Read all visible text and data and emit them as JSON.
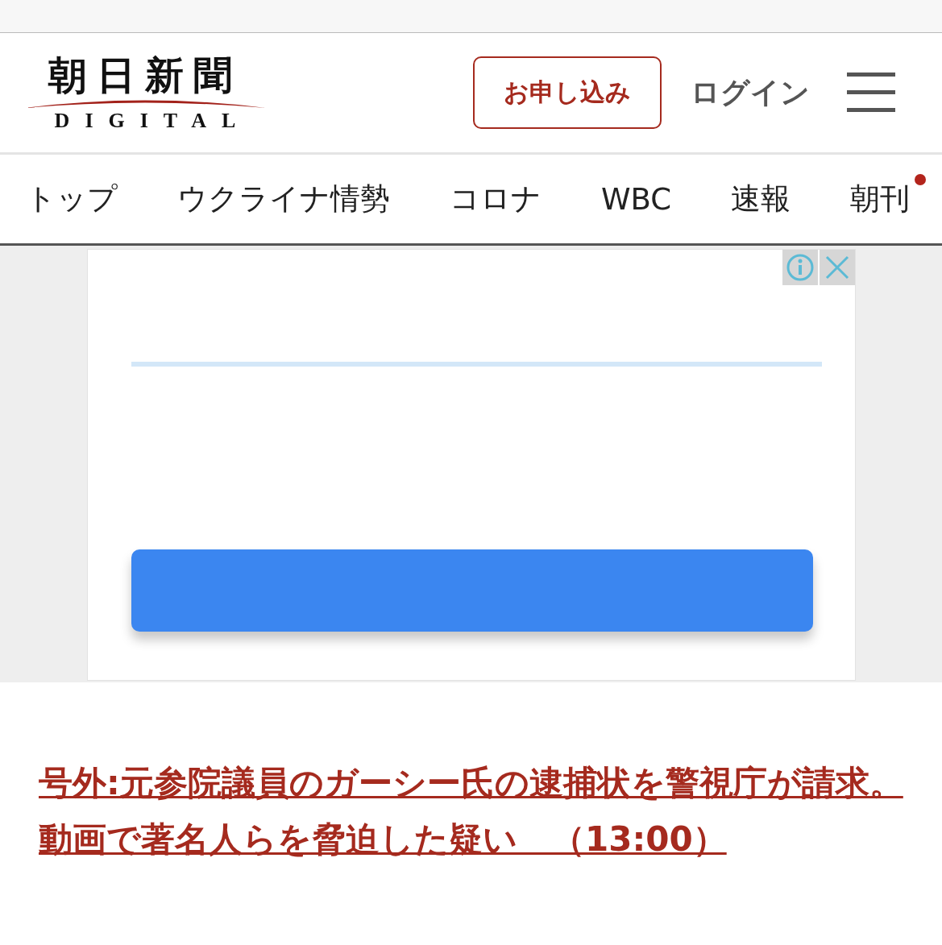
{
  "header": {
    "logo": {
      "title": "朝日新聞",
      "subtitle": "DIGITAL"
    },
    "subscribe_button": "お申し込み",
    "login_link": "ログイン"
  },
  "nav": {
    "items": [
      {
        "label": "トップ",
        "badge": false
      },
      {
        "label": "ウクライナ情勢",
        "badge": false
      },
      {
        "label": "コロナ",
        "badge": false
      },
      {
        "label": "WBC",
        "badge": false
      },
      {
        "label": "速報",
        "badge": false
      },
      {
        "label": "朝刊",
        "badge": true
      }
    ]
  },
  "ad": {
    "kind": "blank"
  },
  "headline": {
    "text": "号外:元参院議員のガーシー氏の逮捕状を警視庁が請求。動画で著名人らを脅迫した疑い　（13:00）"
  }
}
